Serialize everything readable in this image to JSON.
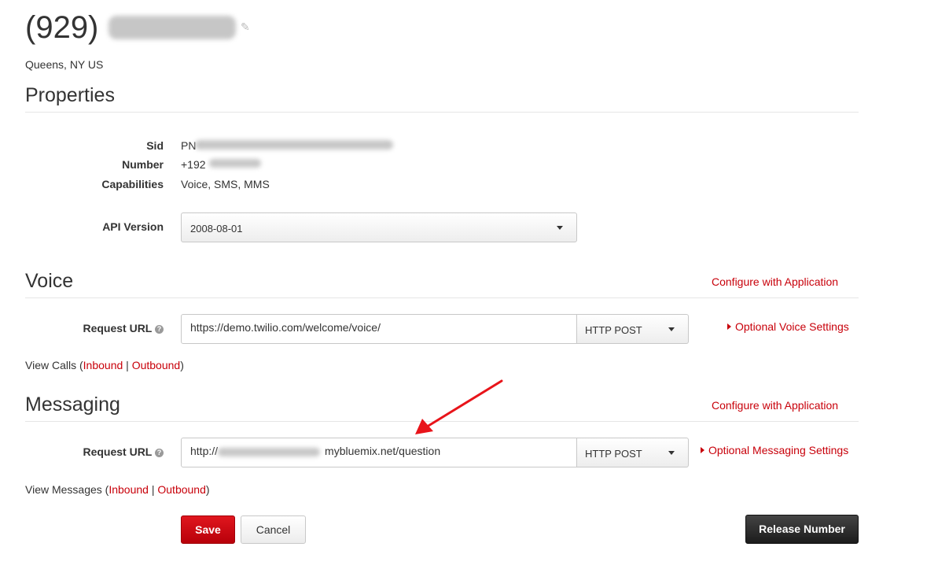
{
  "header": {
    "number_prefix": "(929)",
    "location": "Queens, NY US",
    "edit_icon": "pencil-icon"
  },
  "properties": {
    "heading": "Properties",
    "sid_label": "Sid",
    "sid_value": "PN",
    "number_label": "Number",
    "number_value": "+192",
    "capabilities_label": "Capabilities",
    "capabilities_value": "Voice, SMS, MMS",
    "api_label": "API Version",
    "api_value": "2008-08-01"
  },
  "voice": {
    "heading": "Voice",
    "configure_link": "Configure with Application",
    "request_label": "Request URL",
    "request_url": "https://demo.twilio.com/welcome/voice/",
    "method": "HTTP POST",
    "optional_settings": "Optional Voice Settings",
    "view_prefix": "View Calls (",
    "inbound": "Inbound",
    "separator": " | ",
    "outbound": "Outbound",
    "view_suffix": ")"
  },
  "messaging": {
    "heading": "Messaging",
    "configure_link": "Configure with Application",
    "request_label": "Request URL",
    "url_prefix": "http://",
    "url_suffix": "mybluemix.net/question",
    "method": "HTTP POST",
    "optional_settings": "Optional Messaging Settings",
    "view_prefix": "View Messages (",
    "inbound": "Inbound",
    "separator": " | ",
    "outbound": "Outbound",
    "view_suffix": ")"
  },
  "actions": {
    "save": "Save",
    "cancel": "Cancel",
    "release": "Release Number"
  },
  "help_icon_glyph": "?",
  "colors": {
    "accent": "#c8000a",
    "arrow": "#e8141a",
    "dark_button": "#222222"
  }
}
